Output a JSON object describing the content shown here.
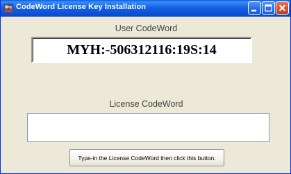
{
  "window": {
    "title": "CodeWord License Key Installation"
  },
  "titlebar_buttons": {
    "minimize_icon": "minimize-icon",
    "maximize_icon": "maximize-icon",
    "close_icon": "close-icon"
  },
  "user_codeword": {
    "label": "User CodeWord",
    "value": "MYH:-506312116:19S:14"
  },
  "license_codeword": {
    "label": "License CodeWord",
    "value": "",
    "placeholder": ""
  },
  "action_button": {
    "label": "Type-in the License CodeWord then click this button."
  },
  "colors": {
    "titlebar": "#0b4fd3",
    "window_bg": "#ece9d8",
    "close_button": "#d9522e"
  }
}
